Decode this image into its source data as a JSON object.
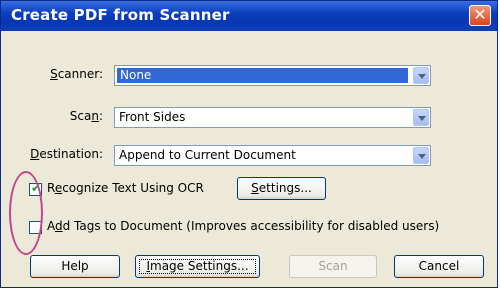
{
  "window": {
    "title": "Create PDF from Scanner",
    "close_glyph": "✕"
  },
  "scanner": {
    "label_pre": "",
    "label_u": "S",
    "label_post": "canner:",
    "value": "None"
  },
  "scan": {
    "label_pre": "Sca",
    "label_u": "n",
    "label_post": ":",
    "value": "Front Sides"
  },
  "destination": {
    "label_pre": "",
    "label_u": "D",
    "label_post": "estination:",
    "value": "Append to Current Document"
  },
  "ocr": {
    "checked": true,
    "label_pre": "R",
    "label_u": "e",
    "label_post": "cognize Text Using OCR",
    "settings_pre": "S",
    "settings_u": "e",
    "settings_post": "ttings..."
  },
  "tags": {
    "checked": false,
    "label_pre": "A",
    "label_u": "d",
    "label_post": "d Tags to Document (Improves accessibility for disabled users)"
  },
  "buttons": {
    "help": "Help",
    "image_settings_pre": "",
    "image_settings_u": "I",
    "image_settings_post": "mage Settings...",
    "scan": "Scan",
    "cancel": "Cancel"
  },
  "colors": {
    "title_bar": "#0b3fbf",
    "highlight": "#3168d5",
    "annotation_circle": "#c2468a"
  }
}
